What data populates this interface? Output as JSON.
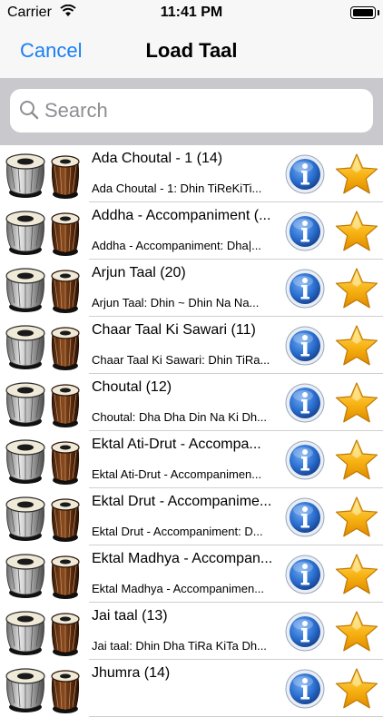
{
  "status": {
    "carrier": "Carrier",
    "time": "11:41 PM"
  },
  "nav": {
    "cancel_label": "Cancel",
    "title": "Load Taal"
  },
  "search": {
    "placeholder": "Search",
    "value": ""
  },
  "items": [
    {
      "title": "Ada Choutal - 1 (14)",
      "subtitle": "Ada Choutal - 1: Dhin TiReKiTi..."
    },
    {
      "title": "Addha - Accompaniment (...",
      "subtitle": "Addha - Accompaniment: Dha|..."
    },
    {
      "title": "Arjun Taal (20)",
      "subtitle": "Arjun Taal: Dhin ~ Dhin Na Na..."
    },
    {
      "title": "Chaar Taal Ki Sawari (11)",
      "subtitle": "Chaar Taal Ki Sawari: Dhin TiRa..."
    },
    {
      "title": "Choutal (12)",
      "subtitle": "Choutal: Dha Dha Din Na Ki Dh..."
    },
    {
      "title": "Ektal Ati-Drut - Accompa...",
      "subtitle": "Ektal Ati-Drut - Accompanimen..."
    },
    {
      "title": "Ektal Drut - Accompanime...",
      "subtitle": "Ektal Drut - Accompaniment: D..."
    },
    {
      "title": "Ektal Madhya - Accompan...",
      "subtitle": "Ektal Madhya - Accompanimen..."
    },
    {
      "title": "Jai taal (13)",
      "subtitle": "Jai taal: Dhin Dha TiRa KiTa Dh..."
    },
    {
      "title": "Jhumra (14)",
      "subtitle": ""
    }
  ],
  "icons": {
    "row_image": "tabla-drums-icon",
    "info": "info-icon",
    "favorite": "star-icon",
    "search": "search-icon",
    "wifi": "wifi-icon",
    "battery": "battery-icon"
  },
  "colors": {
    "accent": "#1a7ff5",
    "nav_background": "#f7f7f7",
    "search_background": "#c8c8cd",
    "star": "#f7b212",
    "info_blue": "#1e5fc0"
  }
}
